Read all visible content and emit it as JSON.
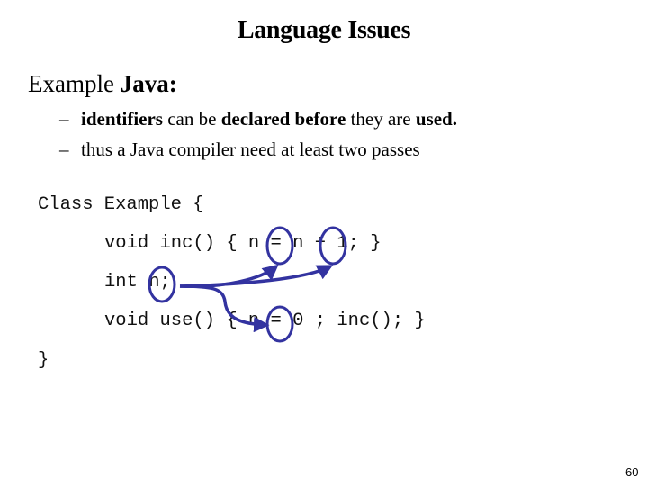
{
  "slide": {
    "title": "Language Issues",
    "intro": {
      "prefix": "Example ",
      "bold": "Java:"
    },
    "bullets": [
      {
        "dash": "–",
        "segments": [
          {
            "text": "identifiers",
            "bold": true
          },
          {
            "text": " can be ",
            "bold": false
          },
          {
            "text": "declared before",
            "bold": true
          },
          {
            "text": " they are ",
            "bold": false
          },
          {
            "text": "used.",
            "bold": true
          }
        ]
      },
      {
        "dash": "–",
        "segments": [
          {
            "text": "thus a Java compiler need at least two passes",
            "bold": false
          }
        ]
      }
    ],
    "code_lines": [
      "Class Example {",
      "void inc() { n = n + 1; }",
      "int n;",
      "void use() { n = 0 ; inc(); }",
      "}"
    ],
    "annotation_color": "#3333a0",
    "page_number": "60"
  }
}
